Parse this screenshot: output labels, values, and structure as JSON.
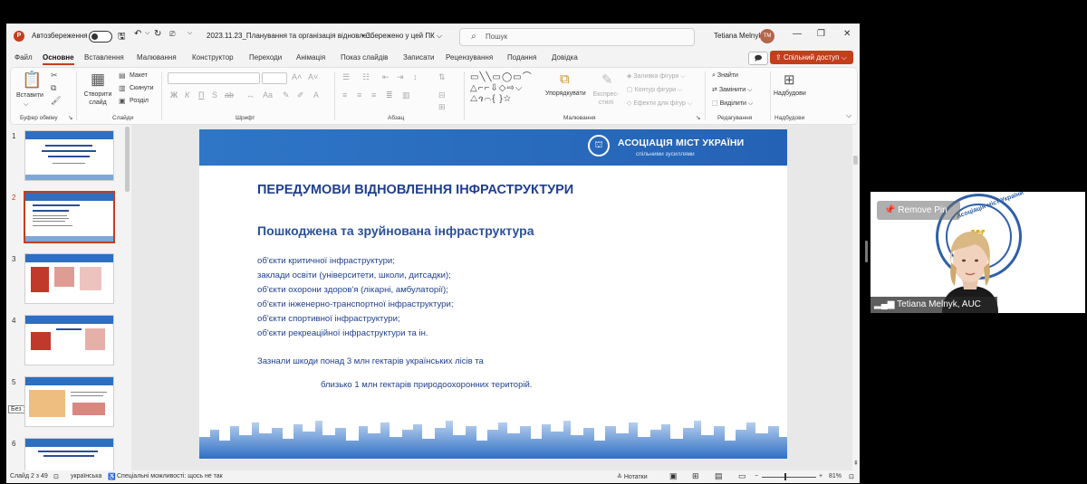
{
  "titlebar": {
    "app_logo": "P",
    "autosave_label": "Автозбереження",
    "file_name": "2023.11.23_Планування та організація відновле...",
    "save_status": "• Збережено у цей ПК ⌵",
    "search_placeholder": "Пошук",
    "user_name": "Tetiana Melnyk",
    "user_initials": "TM"
  },
  "menu": {
    "items": [
      "Файл",
      "Основне",
      "Вставлення",
      "Малювання",
      "Конструктор",
      "Переходи",
      "Анімація",
      "Показ слайдів",
      "Записати",
      "Рецензування",
      "Подання",
      "Довідка"
    ],
    "active": "Основне",
    "share_label": "Спільний доступ"
  },
  "ribbon": {
    "paste_label": "Вставити",
    "clipboard_group": "Буфер обміну",
    "new_slide_label": "Створити слайд",
    "layout_label": "Макет",
    "reset_label": "Скинути",
    "section_label": "Розділ",
    "slides_group": "Слайди",
    "font_group": "Шрифт",
    "paragraph_group": "Абзац",
    "arrange_label": "Упорядкувати",
    "quick_styles_label": "Експрес-стилі",
    "shape_fill_label": "Заливка фігури",
    "shape_outline_label": "Контур фігури",
    "shape_effects_label": "Ефекти для фігур",
    "drawing_group": "Малювання",
    "find_label": "Знайти",
    "replace_label": "Замінити",
    "select_label": "Виділити",
    "editing_group": "Редагування",
    "addins_label": "Надбудови",
    "addins_group": "Надбудови",
    "font_buttons": [
      "Ж",
      "К",
      "П",
      "S",
      "ab"
    ]
  },
  "thumbnails": {
    "numbers": [
      "1",
      "2",
      "3",
      "4",
      "5",
      "6"
    ],
    "active_index": 2,
    "tooltip": "Без заголовка"
  },
  "slide": {
    "org_name": "АСОЦІАЦІЯ МІСТ УКРАЇНИ",
    "org_tagline": "спільними зусиллями",
    "title": "ПЕРЕДУМОВИ ВІДНОВЛЕННЯ ІНФРАСТРУКТУРИ",
    "subtitle": "Пошкоджена та зруйнована інфраструктура",
    "bullets": [
      "об'єкти критичної інфраструктури;",
      "заклади освіти (університети, школи, дитсадки);",
      "об'єкти охорони здоров'я (лікарні, амбулаторії);",
      "об'єкти інженерно-транспортної інфраструктури;",
      "об'єкти спортивної інфраструктури;",
      "об'єкти рекреаційної інфраструктури та ін."
    ],
    "note_line1": "Зазнали шкоди понад 3 млн гектарів українських лісів та",
    "note_line2": "близько 1 млн гектарів природоохоронних територій."
  },
  "statusbar": {
    "slide_counter": "Слайд 2 з 49",
    "language": "українська",
    "accessibility": "Спеціальні можливості: щось не так",
    "notes_label": "Нотатки",
    "zoom": "81%"
  },
  "video": {
    "pin_label": "Remove Pin",
    "participant_name": "Tetiana Melnyk, AUC",
    "emblem_text": "Асоціація міст України"
  },
  "colors": {
    "accent": "#c43e1c",
    "slide_blue": "#2462b5",
    "slide_text": "#1f3f8f"
  }
}
